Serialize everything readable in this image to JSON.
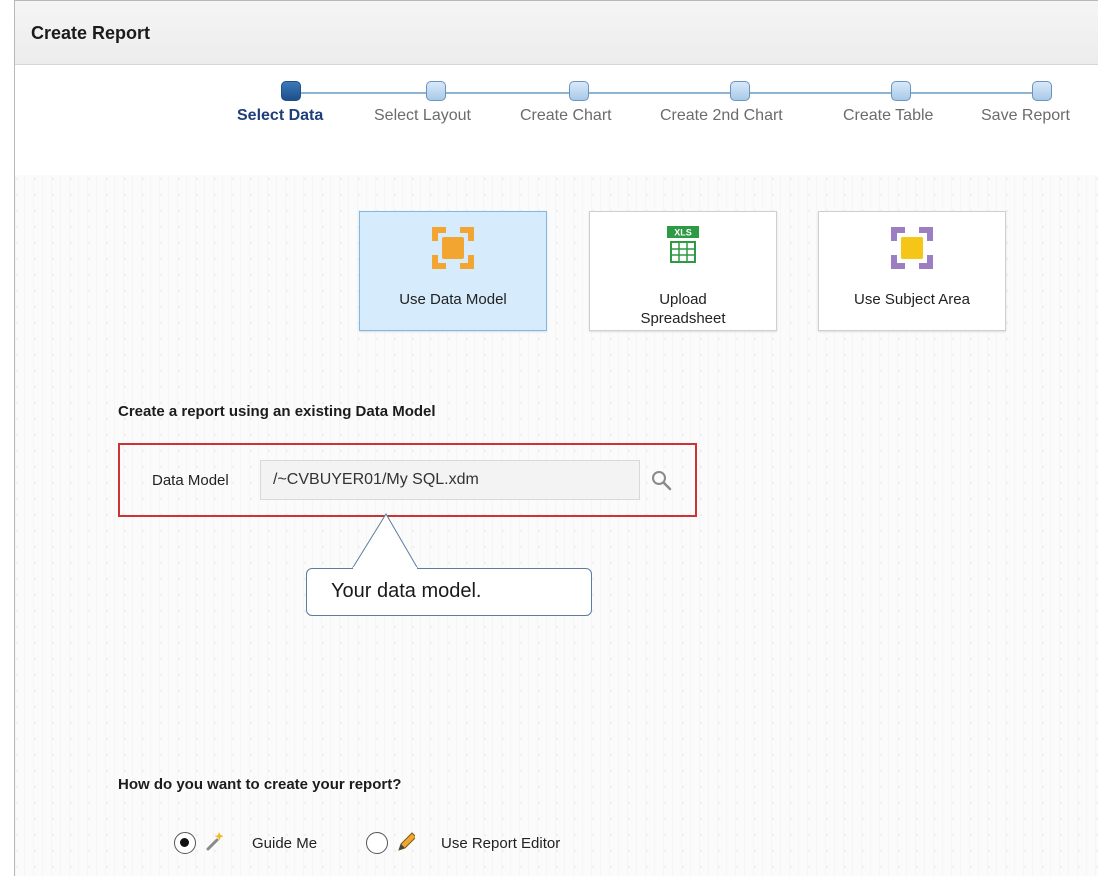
{
  "window": {
    "title": "Create Report"
  },
  "wizard": {
    "steps": [
      {
        "label": "Select Data",
        "active": true
      },
      {
        "label": "Select Layout",
        "active": false
      },
      {
        "label": "Create Chart",
        "active": false
      },
      {
        "label": "Create 2nd Chart",
        "active": false
      },
      {
        "label": "Create Table",
        "active": false
      },
      {
        "label": "Save Report",
        "active": false
      }
    ]
  },
  "data_sources": [
    {
      "label": "Use Data Model",
      "icon": "data-model-icon",
      "selected": true
    },
    {
      "label": "Upload",
      "label2": "Spreadsheet",
      "icon": "spreadsheet-icon",
      "badge": "XLS",
      "selected": false
    },
    {
      "label": "Use Subject Area",
      "icon": "subject-area-icon",
      "selected": false
    }
  ],
  "data_model_section": {
    "heading": "Create a report using an existing Data Model",
    "field_label": "Data Model",
    "field_value": "/~CVBUYER01/My SQL.xdm",
    "callout": "Your data model."
  },
  "create_method": {
    "heading": "How do you want to create your report?",
    "options": [
      {
        "label": "Guide Me",
        "icon": "wand-icon",
        "checked": true
      },
      {
        "label": "Use Report Editor",
        "icon": "pencil-icon",
        "checked": false
      }
    ]
  },
  "colors": {
    "accent": "#1f3f7a",
    "selected_tile": "#d6ebfb",
    "highlight_border": "#cc3333",
    "data_model_orange": "#f2a531",
    "subject_area_purple": "#9b7fc2",
    "xls_green": "#2e9a43"
  }
}
